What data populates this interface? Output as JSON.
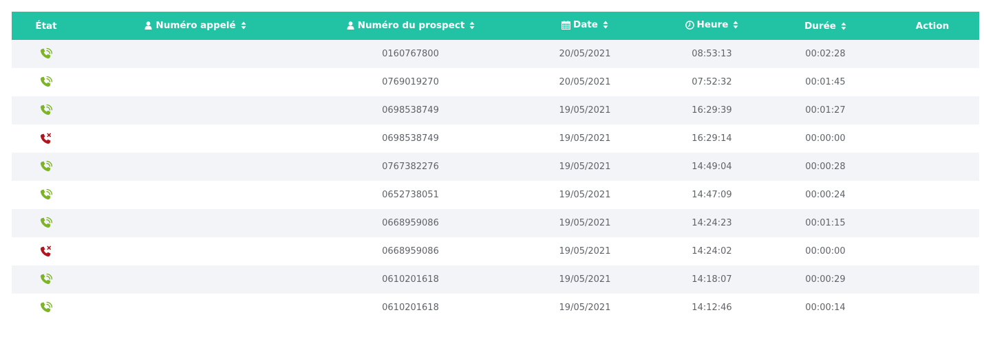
{
  "header": {
    "state": "État",
    "called_number": "Numéro appelé",
    "prospect_number": "Numéro du prospect",
    "date": "Date",
    "time": "Heure",
    "duration": "Durée",
    "action": "Action"
  },
  "colors": {
    "header_bg": "#22c3a5",
    "answered": "#7db327",
    "missed": "#b0161e",
    "row_alt": "#f3f4f8"
  },
  "rows": [
    {
      "state": "answered",
      "called": "",
      "prospect": "0160767800",
      "date": "20/05/2021",
      "time": "08:53:13",
      "duration": "00:02:28",
      "action": ""
    },
    {
      "state": "answered",
      "called": "",
      "prospect": "0769019270",
      "date": "20/05/2021",
      "time": "07:52:32",
      "duration": "00:01:45",
      "action": ""
    },
    {
      "state": "answered",
      "called": "",
      "prospect": "0698538749",
      "date": "19/05/2021",
      "time": "16:29:39",
      "duration": "00:01:27",
      "action": ""
    },
    {
      "state": "missed",
      "called": "",
      "prospect": "0698538749",
      "date": "19/05/2021",
      "time": "16:29:14",
      "duration": "00:00:00",
      "action": ""
    },
    {
      "state": "answered",
      "called": "",
      "prospect": "0767382276",
      "date": "19/05/2021",
      "time": "14:49:04",
      "duration": "00:00:28",
      "action": ""
    },
    {
      "state": "answered",
      "called": "",
      "prospect": "0652738051",
      "date": "19/05/2021",
      "time": "14:47:09",
      "duration": "00:00:24",
      "action": ""
    },
    {
      "state": "answered",
      "called": "",
      "prospect": "0668959086",
      "date": "19/05/2021",
      "time": "14:24:23",
      "duration": "00:01:15",
      "action": ""
    },
    {
      "state": "missed",
      "called": "",
      "prospect": "0668959086",
      "date": "19/05/2021",
      "time": "14:24:02",
      "duration": "00:00:00",
      "action": ""
    },
    {
      "state": "answered",
      "called": "",
      "prospect": "0610201618",
      "date": "19/05/2021",
      "time": "14:18:07",
      "duration": "00:00:29",
      "action": ""
    },
    {
      "state": "answered",
      "called": "",
      "prospect": "0610201618",
      "date": "19/05/2021",
      "time": "14:12:46",
      "duration": "00:00:14",
      "action": ""
    }
  ]
}
